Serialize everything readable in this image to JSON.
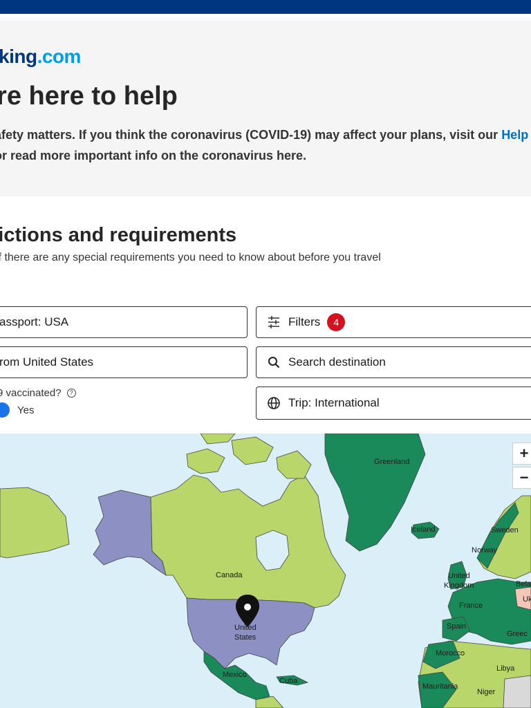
{
  "logo": {
    "part1": "king",
    "part2": ".com"
  },
  "hero": {
    "title": "'re here to help",
    "text_line1": "afety matters. If you think the coronavirus (COVID-19) may affect your plans, visit our ",
    "help_link": "Help",
    "text_line2": " or read more important info on the coronavirus here."
  },
  "section": {
    "title": "rictions and requirements",
    "subtitle": "if there are any special requirements you need to know about before you travel"
  },
  "form": {
    "passport": "assport: USA",
    "origin": "rom United States",
    "filters_label": "Filters",
    "filters_count": "4",
    "search_placeholder": "Search destination",
    "trip": "Trip: International",
    "vaccinated_label": "9 vaccinated?",
    "vaccinated_option": "Yes"
  },
  "map": {
    "zoom_in": "+",
    "zoom_out": "−",
    "labels": {
      "greenland": "Greenland",
      "canada": "Canada",
      "united_states_1": "United",
      "united_states_2": "States",
      "mexico": "Mexico",
      "cuba": "Cuba",
      "iceland": "Iceland",
      "sweden": "Sweden",
      "norway": "Norway",
      "uk_1": "United",
      "uk_2": "Kingdom",
      "france": "France",
      "spain": "Spain",
      "morocco": "Morocco",
      "mauritania": "Mauritania",
      "libya": "Libya",
      "niger": "Niger",
      "greece": "Greec",
      "bela": "Bela",
      "uk_frag": "Uk"
    },
    "colors": {
      "water": "#dbeff8",
      "open": "#b9d66b",
      "restricted": "#1b8a5a",
      "origin": "#8c90c2",
      "partial": "#f2c7b8"
    }
  }
}
